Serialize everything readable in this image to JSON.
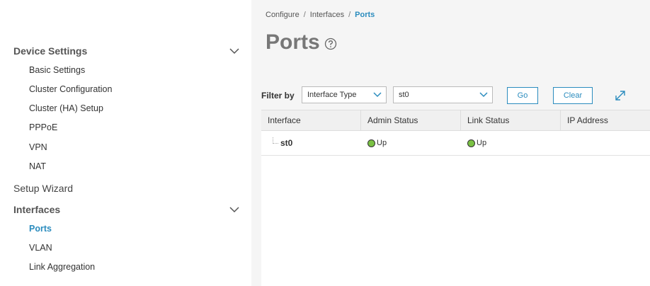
{
  "sidebar": {
    "device_settings": {
      "title": "Device Settings",
      "items": [
        "Basic Settings",
        "Cluster Configuration",
        "Cluster (HA) Setup",
        "PPPoE",
        "VPN",
        "NAT"
      ]
    },
    "setup_wizard": "Setup Wizard",
    "interfaces": {
      "title": "Interfaces",
      "items": [
        "Ports",
        "VLAN",
        "Link Aggregation"
      ],
      "active": "Ports"
    }
  },
  "breadcrumb": {
    "items": [
      "Configure",
      "Interfaces",
      "Ports"
    ],
    "separator": "/"
  },
  "page": {
    "title": "Ports"
  },
  "filter": {
    "label": "Filter by",
    "type_select": "Interface Type",
    "value_select": "st0",
    "go_label": "Go",
    "clear_label": "Clear"
  },
  "table": {
    "columns": [
      "Interface",
      "Admin Status",
      "Link Status",
      "IP Address"
    ],
    "rows": [
      {
        "interface": "st0",
        "admin_status": "Up",
        "link_status": "Up",
        "ip_address": ""
      }
    ]
  },
  "colors": {
    "accent": "#2b8cbe",
    "status_up": "#7ac143",
    "main_bg": "#f5f5f5"
  }
}
